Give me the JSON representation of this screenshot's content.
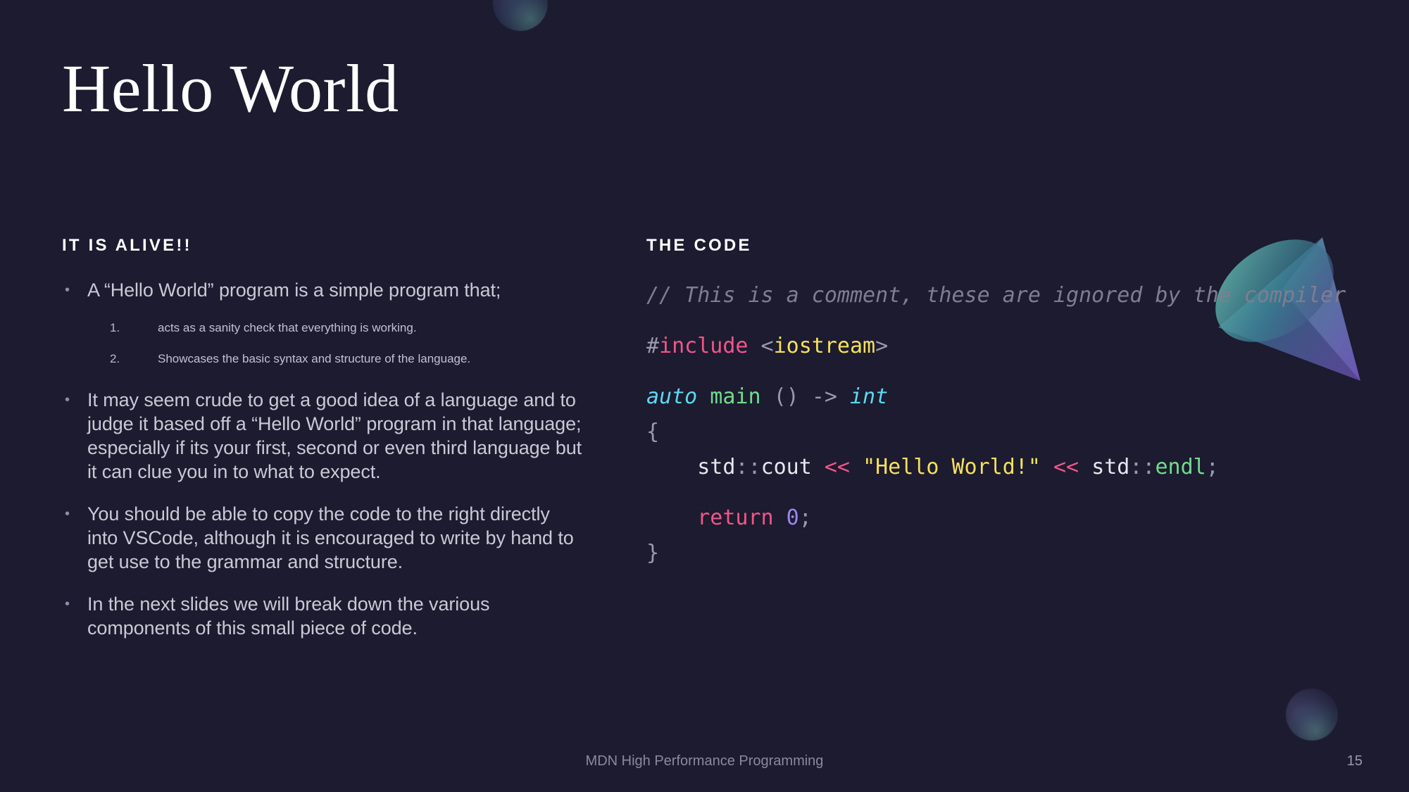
{
  "slide": {
    "title": "Hello World",
    "background_color": "#1c1b2f",
    "footer": "MDN High Performance Programming",
    "page_number": "15"
  },
  "left": {
    "heading": "IT IS ALIVE!!",
    "bullet_marker": "•",
    "bullets": [
      {
        "text": "A “Hello World” program is a simple program that;"
      },
      {
        "text": "It may seem crude to get a good idea of a language and to judge it based off a “Hello World” program in that language; especially if its your first, second or even third language but it can clue you in to what to expect."
      },
      {
        "text": "You should be able to copy the code to the right directly into VSCode, although it is encouraged to write by hand to get use to the grammar and structure."
      },
      {
        "text": "In the next slides we will break down the various components of this small piece of code."
      }
    ],
    "sublist": [
      {
        "number": "1.",
        "text": "acts as a sanity check that everything is working."
      },
      {
        "number": "2.",
        "text": "Showcases the basic syntax and structure of the language."
      }
    ]
  },
  "right": {
    "heading": "THE CODE",
    "code": {
      "language": "cpp",
      "comment_line": "// This is a comment, these are ignored by the compiler",
      "include_hash": "#",
      "include_keyword": "include",
      "include_open": " <",
      "include_header": "iostream",
      "include_close": ">",
      "auto_keyword": "auto",
      "main_name": " main ",
      "parens": "() ",
      "arrow": "-> ",
      "return_type": "int",
      "brace_open": "{",
      "indent": "    ",
      "std_a": "std",
      "scope_a": "::",
      "cout": "cout",
      "shift_a": " << ",
      "string_literal": "\"Hello World!\"",
      "shift_b": " << ",
      "std_b": "std",
      "scope_b": "::",
      "endl": "endl",
      "semi_a": ";",
      "return_keyword": "return",
      "return_value": " 0",
      "semi_b": ";",
      "brace_close": "}"
    }
  },
  "decor": {
    "cone_label": "cone-shape",
    "sphere_top_label": "sphere-top",
    "sphere_bottom_label": "sphere-bottom",
    "cone_teal": "#3f9a9a",
    "cone_purple": "#5b4b9e"
  }
}
